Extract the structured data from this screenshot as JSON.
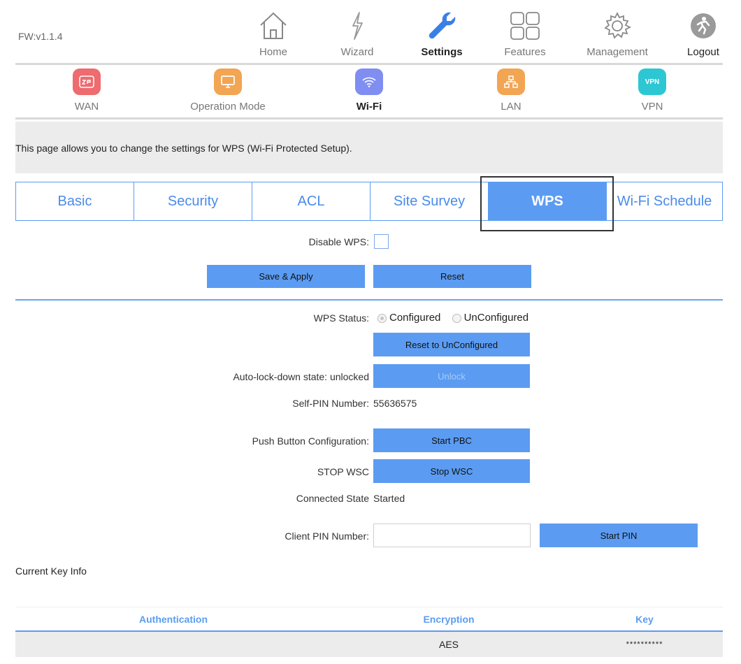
{
  "firmware": "FW:v1.1.4",
  "top_nav": {
    "home": "Home",
    "wizard": "Wizard",
    "settings": "Settings",
    "features": "Features",
    "management": "Management",
    "logout": "Logout",
    "active": "Settings"
  },
  "sub_nav": {
    "wan": "WAN",
    "wan_badge": "",
    "operation_mode": "Operation Mode",
    "wifi": "Wi-Fi",
    "lan": "LAN",
    "vpn": "VPN",
    "vpn_badge": "VPN",
    "active": "Wi-Fi"
  },
  "description": "This page allows you to change the settings for WPS (Wi-Fi Protected Setup).",
  "tabs": {
    "basic": "Basic",
    "security": "Security",
    "acl": "ACL",
    "site_survey": "Site Survey",
    "wps": "WPS",
    "wifi_schedule": "Wi-Fi Schedule",
    "active": "WPS"
  },
  "form": {
    "disable_wps_label": "Disable WPS:",
    "disable_wps_checked": false,
    "save_apply": "Save & Apply",
    "reset": "Reset",
    "wps_status_label": "WPS Status:",
    "status_configured": "Configured",
    "status_unconfigured": "UnConfigured",
    "status_selected": "Configured",
    "reset_unconfigured": "Reset to UnConfigured",
    "autolock_label": "Auto-lock-down state: unlocked",
    "unlock": "Unlock",
    "self_pin_label": "Self-PIN Number:",
    "self_pin_value": "55636575",
    "pbc_label": "Push Button Configuration:",
    "start_pbc": "Start PBC",
    "stop_wsc_label": "STOP WSC",
    "stop_wsc": "Stop WSC",
    "connected_state_label": "Connected State",
    "connected_state_value": "Started",
    "client_pin_label": "Client PIN Number:",
    "client_pin_value": "",
    "start_pin": "Start PIN"
  },
  "key_info": {
    "title": "Current Key Info",
    "headers": {
      "authentication": "Authentication",
      "encryption": "Encryption",
      "key": "Key"
    },
    "row": {
      "authentication": "",
      "encryption": "AES",
      "key": "**********"
    }
  },
  "colors": {
    "accent": "#5b9cf2",
    "wan": "#ee6b6f",
    "operation_mode": "#f2a553",
    "wifi": "#7f8ef0",
    "lan": "#f2a553",
    "vpn": "#2dc7d4"
  }
}
